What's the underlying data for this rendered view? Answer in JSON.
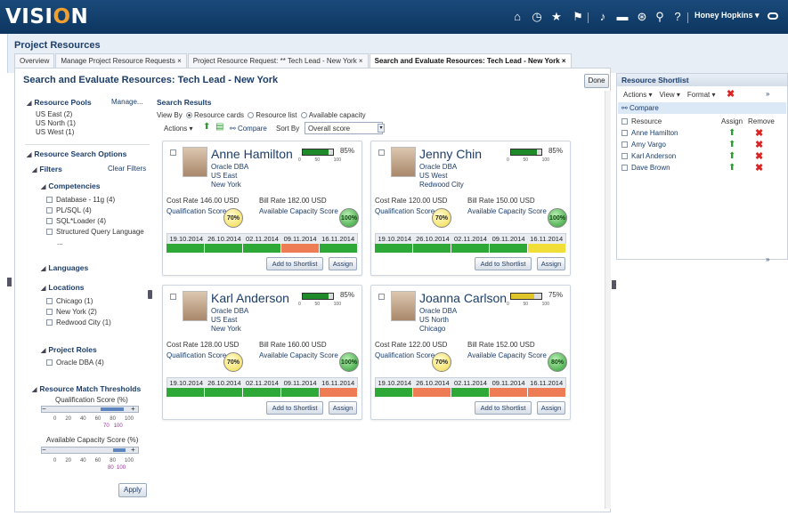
{
  "app": {
    "logo_pre": "VISI",
    "logo_o": "O",
    "logo_post": "N",
    "user": "Honey Hopkins ▾",
    "title": "Project Resources"
  },
  "nav_icons": [
    "home-icon",
    "clock-icon",
    "star-icon",
    "flag-icon",
    "bell-icon",
    "chat-icon",
    "accessibility-icon",
    "search-icon",
    "help-icon"
  ],
  "tabs": [
    {
      "label": "Overview"
    },
    {
      "label": "Manage Project Resource Requests ×"
    },
    {
      "label": "Project Resource Request: ** Tech Lead - New York ×"
    },
    {
      "label": "Search and Evaluate Resources: Tech Lead - New York ×"
    }
  ],
  "page": {
    "title": "Search and Evaluate Resources: Tech Lead - New York",
    "done": "Done"
  },
  "left": {
    "pools_title": "Resource Pools",
    "manage": "Manage...",
    "pools": [
      "US East (2)",
      "US North (1)",
      "US West (1)"
    ],
    "search_options": "Resource Search Options",
    "filters": "Filters",
    "clear_filters": "Clear Filters",
    "competencies": "Competencies",
    "competency_items": [
      "Database - 11g (4)",
      "PL/SQL (4)",
      "SQL*Loader (4)",
      "Structured Query Language",
      "..."
    ],
    "languages": "Languages",
    "locations": "Locations",
    "location_items": [
      "Chicago (1)",
      "New York (2)",
      "Redwood City (1)"
    ],
    "project_roles": "Project Roles",
    "role_items": [
      "Oracle DBA (4)"
    ],
    "thresholds": "Resource Match Thresholds",
    "qual_label": "Qualification Score (%)",
    "cap_label": "Available Capacity Score (%)",
    "ticks": [
      "0",
      "20",
      "40",
      "60",
      "80",
      "100"
    ],
    "qual_range": [
      "70",
      "100"
    ],
    "cap_range": [
      "80",
      "100"
    ],
    "apply": "Apply"
  },
  "results": {
    "title": "Search Results",
    "view_by": "View By",
    "view_opts": [
      "Resource cards",
      "Resource list",
      "Available capacity"
    ],
    "actions": "Actions ▾",
    "compare": "Compare",
    "sort_by": "Sort By",
    "sort_value": "Overall score",
    "dates": [
      "19.10.2014",
      "26.10.2014",
      "02.11.2014",
      "09.11.2014",
      "16.11.2014"
    ],
    "cost_label": "Cost Rate",
    "bill_label": "Bill Rate",
    "qual_label": "Qualification Score",
    "cap_label": "Available Capacity Score",
    "add_btn": "Add to Shortlist",
    "assign_btn": "Assign",
    "scale": [
      "0",
      "50",
      "100"
    ]
  },
  "cards": [
    {
      "name": "Anne Hamilton",
      "role": "Oracle DBA",
      "region": "US East",
      "city": "New York",
      "pct": "85%",
      "fill": 0.85,
      "cost": "146.00 USD",
      "bill": "182.00 USD",
      "qual": "70%",
      "cap": "100%",
      "strip": [
        "g",
        "g",
        "g",
        "r",
        "g"
      ]
    },
    {
      "name": "Jenny Chin",
      "role": "Oracle DBA",
      "region": "US West",
      "city": "Redwood City",
      "pct": "85%",
      "fill": 0.85,
      "cost": "120.00 USD",
      "bill": "150.00 USD",
      "qual": "70%",
      "cap": "100%",
      "strip": [
        "g",
        "g",
        "g",
        "g",
        "y"
      ]
    },
    {
      "name": "Karl Anderson",
      "role": "Oracle DBA",
      "region": "US East",
      "city": "New York",
      "pct": "85%",
      "fill": 0.85,
      "cost": "128.00 USD",
      "bill": "160.00 USD",
      "qual": "70%",
      "cap": "100%",
      "strip": [
        "g",
        "g",
        "g",
        "g",
        "r"
      ]
    },
    {
      "name": "Joanna Carlson",
      "role": "Oracle DBA",
      "region": "US North",
      "city": "Chicago",
      "pct": "75%",
      "fill": 0.75,
      "cost": "122.00 USD",
      "bill": "152.00 USD",
      "qual": "70%",
      "cap": "80%",
      "strip": [
        "g",
        "r",
        "g",
        "r",
        "r"
      ]
    }
  ],
  "shortlist": {
    "title": "Resource Shortlist",
    "toolbar": [
      "Actions ▾",
      "View ▾",
      "Format ▾"
    ],
    "compare": "Compare",
    "col_resource": "Resource",
    "col_assign": "Assign",
    "col_remove": "Remove",
    "rows": [
      "Anne Hamilton",
      "Amy Vargo",
      "Karl Anderson",
      "Dave Brown"
    ],
    "more": "»"
  }
}
